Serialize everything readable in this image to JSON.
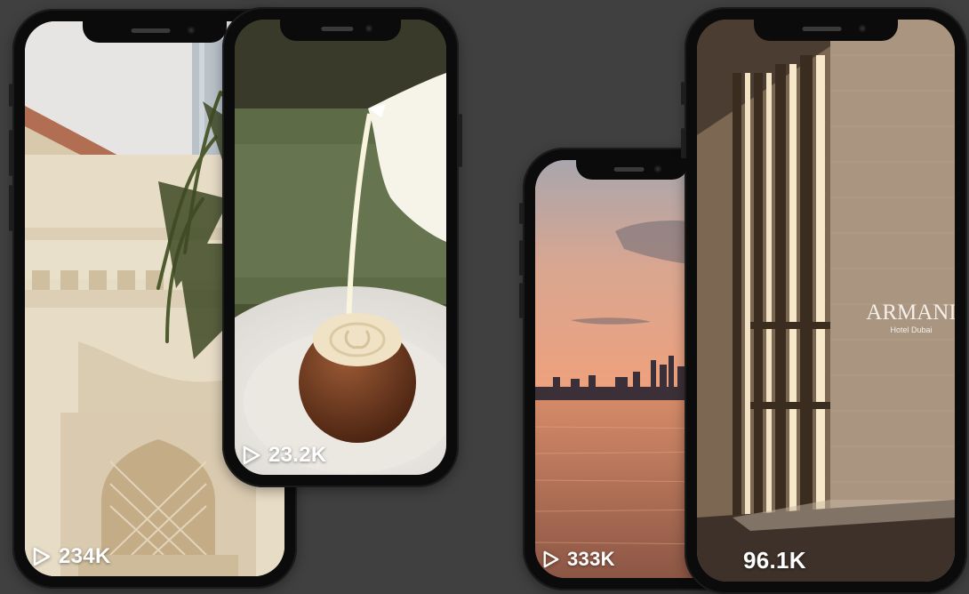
{
  "colors": {
    "background": "#404040",
    "phone_frame": "#0b0b0b",
    "overlay_text": "#ffffff"
  },
  "reels": [
    {
      "id": "palace",
      "play_icon": "play-icon",
      "views": "234K"
    },
    {
      "id": "dessert",
      "play_icon": "play-icon",
      "views": "23.2K"
    },
    {
      "id": "sunset",
      "play_icon": "play-icon",
      "views": "333K"
    },
    {
      "id": "lobby",
      "views": "96.1K",
      "sign": {
        "brand": "ARMANI",
        "sub": "Hotel Dubai"
      }
    }
  ]
}
